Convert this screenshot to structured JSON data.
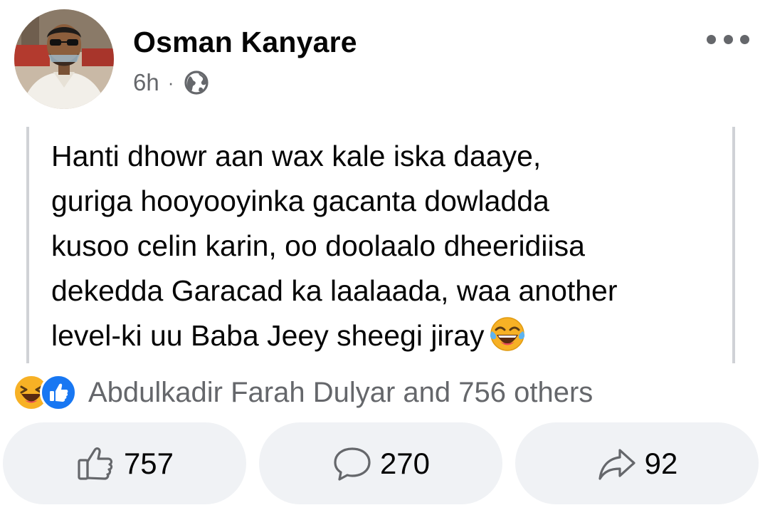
{
  "post": {
    "author": "Osman Kanyare",
    "time": "6h",
    "separator": "·",
    "text": "Hanti dhowr aan wax kale iska daaye,\nguriga hooyooyinka gacanta dowladda\nkusoo celin karin, oo doolaalo dheeridiisa\ndekedda Garacad ka laalaada, waa another\nlevel-ki uu Baba Jeey sheegi jiray"
  },
  "icons": {
    "more": "more-options-icon",
    "privacy": "globe-icon",
    "inline_emoji": "tears-of-joy-emoji",
    "reaction_haha": "haha-reaction-icon",
    "reaction_like": "like-reaction-icon",
    "like": "thumbs-up-icon",
    "comment": "comment-bubble-icon",
    "share": "share-arrow-icon"
  },
  "reactions": {
    "summary": "Abdulkadir Farah Dulyar and 756 others"
  },
  "actions": {
    "like_count": "757",
    "comment_count": "270",
    "share_count": "92"
  },
  "colors": {
    "primary_text": "#050505",
    "secondary_text": "#65676b",
    "button_bg": "#f0f2f5",
    "like_blue": "#1877f2",
    "haha_yellow": "#f7b125"
  }
}
